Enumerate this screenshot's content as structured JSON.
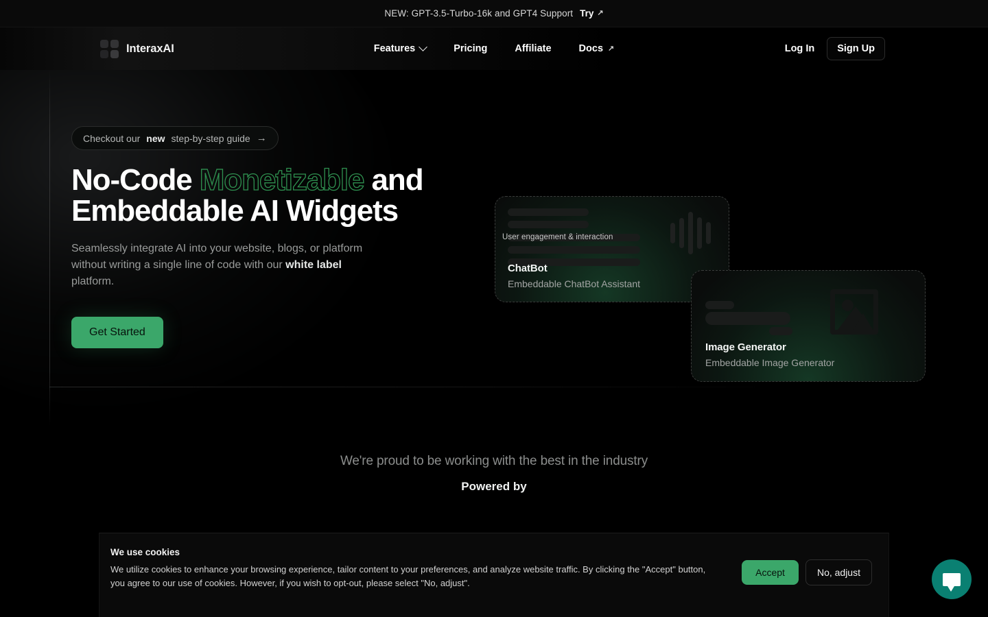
{
  "announcement": {
    "text": "NEW: GPT-3.5-Turbo-16k and GPT4 Support",
    "cta_label": "Try",
    "cta_icon": "arrow-up-right-icon"
  },
  "header": {
    "brand": "InteraxAI",
    "nav": [
      {
        "label": "Features",
        "icon": "chevron-down-icon"
      },
      {
        "label": "Pricing",
        "icon": ""
      },
      {
        "label": "Affiliate",
        "icon": ""
      },
      {
        "label": "Docs",
        "icon": "arrow-up-right-icon"
      }
    ],
    "login_label": "Log In",
    "signup_label": "Sign Up"
  },
  "hero": {
    "pill_prefix": "Checkout our ",
    "pill_bold": "new",
    "pill_suffix": " step-by-step guide",
    "pill_arrow": "→",
    "title_part1": "No-Code ",
    "title_highlight": "Monetizable",
    "title_part2": " and Embeddable AI Widgets",
    "subtitle_part1": "Seamlessly integrate AI into your website, blogs, or platform without writing a single line of code with our ",
    "subtitle_bold": "white label",
    "subtitle_part2": " platform.",
    "cta_label": "Get Started"
  },
  "widgets": [
    {
      "name": "chatbot",
      "overlay_label": "User engagement & interaction",
      "title": "ChatBot",
      "description": "Embeddable ChatBot Assistant",
      "icon": "waveform-icon"
    },
    {
      "name": "image-generator",
      "title": "Image Generator",
      "description": "Embeddable Image Generator",
      "icon": "picture-icon"
    }
  ],
  "partners": {
    "heading": "We're proud to be working with the best in the industry",
    "subheading": "Powered by"
  },
  "cookies": {
    "title": "We use cookies",
    "body": "We utilize cookies to enhance your browsing experience, tailor content to your preferences, and analyze website traffic. By clicking the \"Accept\" button, you agree to our use of cookies. However, if you wish to opt-out, please select \"No, adjust\".",
    "accept_label": "Accept",
    "adjust_label": "No, adjust"
  },
  "chat_widget": {
    "icon": "chat-bubble-icon"
  },
  "colors": {
    "background": "#000000",
    "accent_green": "#3ba76a",
    "outline_green": "#2f9150",
    "chat_teal": "#0a8072",
    "text_primary": "#ffffff",
    "text_muted": "#9a9c9b"
  }
}
